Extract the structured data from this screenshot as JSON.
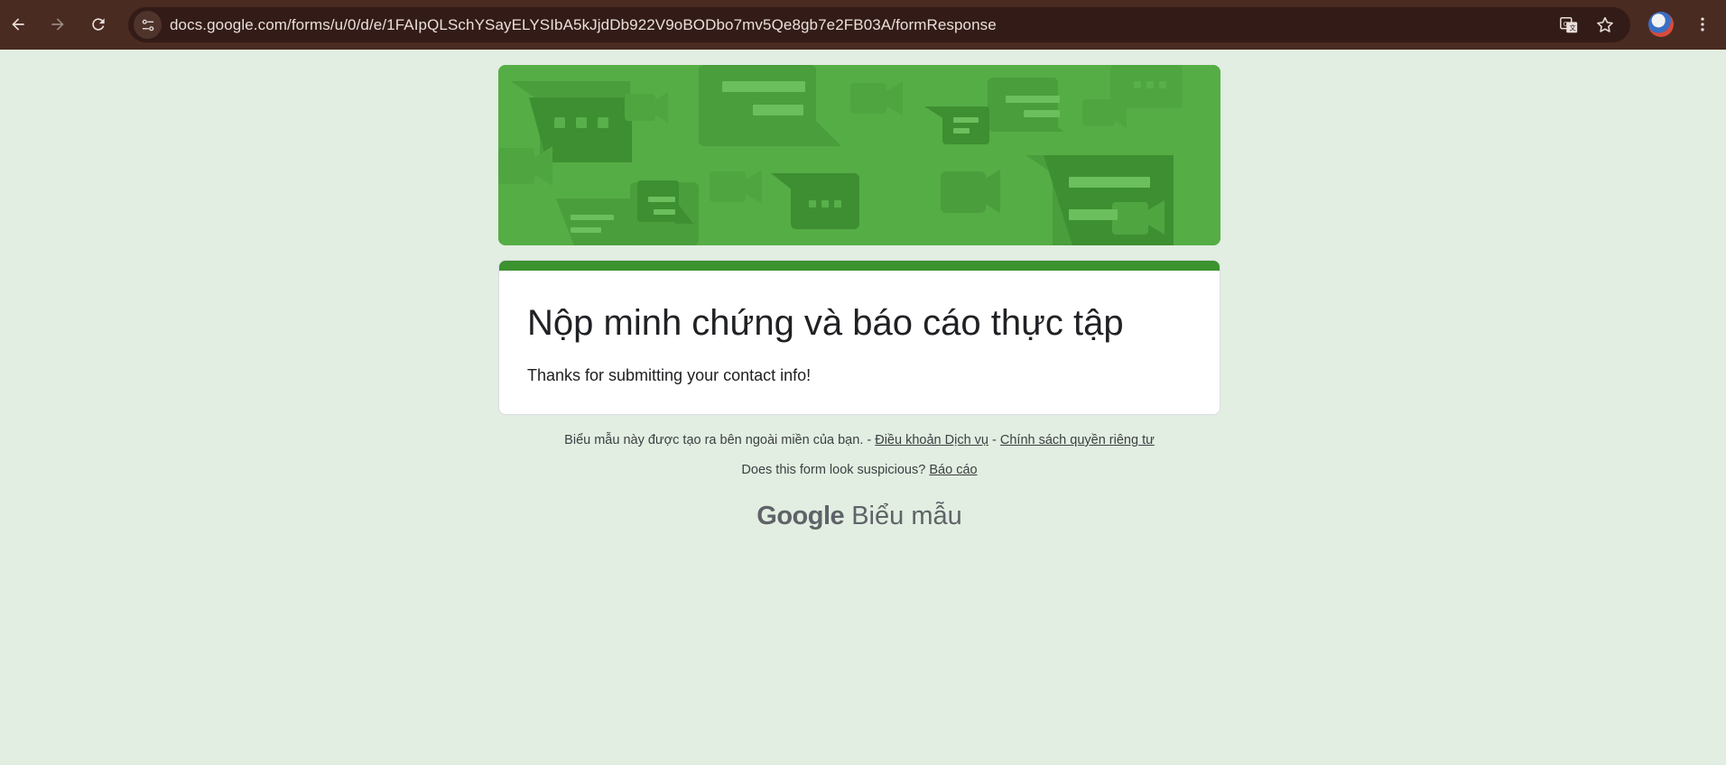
{
  "browser": {
    "url": "docs.google.com/forms/u/0/d/e/1FAIpQLSchYSayELYSIbA5kJjdDb922V9oBODbo7mv5Qe8gb7e2FB03A/formResponse",
    "icons": [
      "back-icon",
      "forward-icon",
      "reload-icon",
      "site-info-icon",
      "translate-icon",
      "star-icon",
      "avatar",
      "more-vert-icon"
    ]
  },
  "form": {
    "title": "Nộp minh chứng và báo cáo thực tập",
    "confirmation": "Thanks for submitting your contact info!"
  },
  "footer": {
    "disclaimer": "Biểu mẫu này được tạo ra bên ngoài miền của bạn. -",
    "terms_link": "Điều khoản Dịch vụ",
    "separator": "-",
    "privacy_link": "Chính sách quyền riêng tư",
    "suspicious_text": "Does this form look suspicious?",
    "report_link": "Báo cáo",
    "brand_google": "Google",
    "brand_product": "Biểu mẫu"
  },
  "colors": {
    "page_bg": "#e2eee1",
    "chrome_bg": "#4a2b21",
    "banner_green": "#52ac43",
    "accent_green": "#3c922f"
  }
}
